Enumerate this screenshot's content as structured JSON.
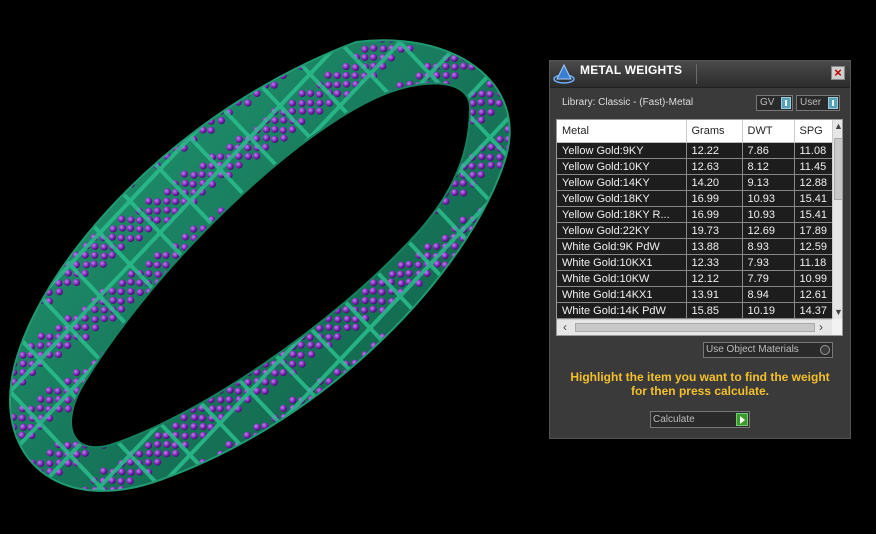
{
  "panel": {
    "title": "METAL WEIGHTS",
    "close_label": "×",
    "library_label": "Library: Classic - (Fast)-Metal",
    "toggle_gv": "GV",
    "toggle_user": "User",
    "table": {
      "columns": [
        "Metal",
        "Grams",
        "DWT",
        "SPG"
      ],
      "rows": [
        [
          "Yellow Gold:9KY",
          "12.22",
          "7.86",
          "11.08"
        ],
        [
          "Yellow Gold:10KY",
          "12.63",
          "8.12",
          "11.45"
        ],
        [
          "Yellow Gold:14KY",
          "14.20",
          "9.13",
          "12.88"
        ],
        [
          "Yellow Gold:18KY",
          "16.99",
          "10.93",
          "15.41"
        ],
        [
          "Yellow Gold:18KY R...",
          "16.99",
          "10.93",
          "15.41"
        ],
        [
          "Yellow Gold:22KY",
          "19.73",
          "12.69",
          "17.89"
        ],
        [
          "White Gold:9K PdW",
          "13.88",
          "8.93",
          "12.59"
        ],
        [
          "White Gold:10KX1",
          "12.33",
          "7.93",
          "11.18"
        ],
        [
          "White Gold:10KW",
          "12.12",
          "7.79",
          "10.99"
        ],
        [
          "White Gold:14KX1",
          "13.91",
          "8.94",
          "12.61"
        ],
        [
          "White Gold:14K PdW",
          "15.85",
          "10.19",
          "14.37"
        ]
      ]
    },
    "use_object_materials": "Use Object Materials",
    "hint_line1": "Highlight the item you want to find the weight",
    "hint_line2": "for then press calculate.",
    "calculate_label": "Calculate"
  },
  "colors": {
    "metal": "#1e8a66",
    "gem": "#8a2ec0",
    "hint": "#f4c02c"
  }
}
